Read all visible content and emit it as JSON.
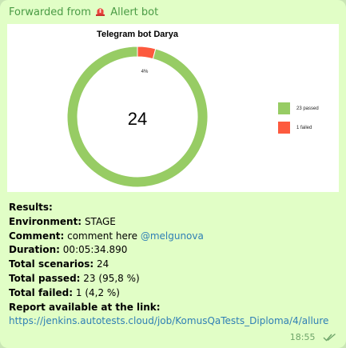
{
  "forward": {
    "prefix": "Forwarded from",
    "bot_name": "Allert bot"
  },
  "chart_data": {
    "type": "pie",
    "title": "Telegram bot Darya",
    "center_label": "24",
    "categories": [
      "passed",
      "failed"
    ],
    "values": [
      23,
      1
    ],
    "slice_labels": [
      "",
      "4%"
    ],
    "legend": [
      "23 passed",
      "1 failed"
    ],
    "colors": [
      "#97cc64",
      "#fd5a3e"
    ],
    "legend_position": "right"
  },
  "message": {
    "results_label": "Results:",
    "environment_label": "Environment:",
    "environment_value": "STAGE",
    "comment_label": "Comment:",
    "comment_value": "comment here",
    "comment_mention": "@melgunova",
    "duration_label": "Duration:",
    "duration_value": "00:05:34.890",
    "scenarios_label": "Total scenarios:",
    "scenarios_value": "24",
    "passed_label": "Total passed:",
    "passed_value": "23 (95,8 %)",
    "failed_label": "Total failed:",
    "failed_value": "1 (4,2 %)",
    "report_label": "Report available at the link:",
    "report_link": "https://jenkins.autotests.cloud/job/KomusQaTests_Diploma/4/allure"
  },
  "meta": {
    "time": "18:55"
  }
}
